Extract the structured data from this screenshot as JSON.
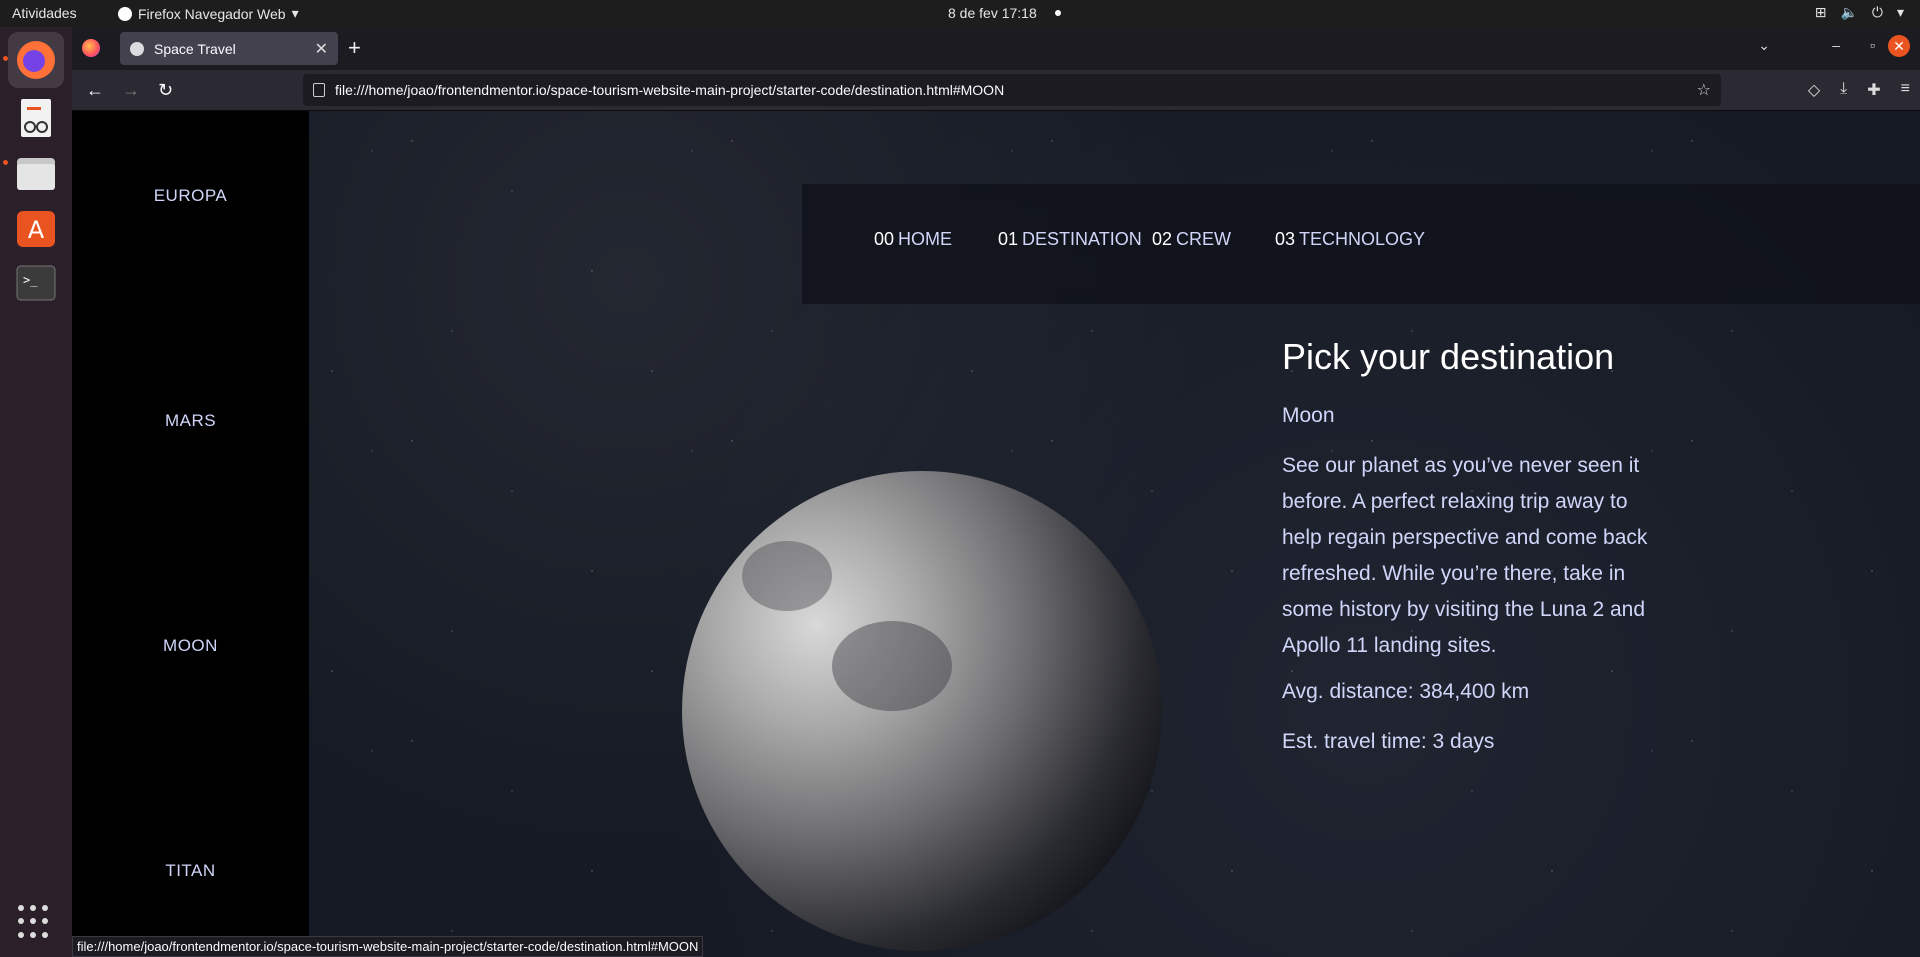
{
  "topbar": {
    "activities": "Atividades",
    "app_name": "Firefox Navegador Web",
    "clock": "8 de fev  17:18"
  },
  "browser": {
    "tab_title": "Space Travel",
    "url": "file:///home/joao/frontendmentor.io/space-tourism-website-main-project/starter-code/destination.html#MOON",
    "status_url": "file:///home/joao/frontendmentor.io/space-tourism-website-main-project/starter-code/destination.html#MOON"
  },
  "sidebar": {
    "destinations": [
      "EUROPA",
      "MARS",
      "MOON",
      "TITAN"
    ]
  },
  "nav": {
    "items": [
      {
        "num": "00",
        "label": "HOME"
      },
      {
        "num": "01",
        "label": "DESTINATION"
      },
      {
        "num": "02",
        "label": "CREW"
      },
      {
        "num": "03",
        "label": "TECHNOLOGY"
      }
    ]
  },
  "main": {
    "title": "Pick your destination",
    "destination": "Moon",
    "description": "See our planet as you’ve never seen it before. A perfect relaxing trip away to help regain perspective and come back refreshed. While you’re there, take in some history by visiting the Luna 2 and Apollo 11 landing sites.",
    "distance": "Avg. distance: 384,400 km",
    "travel_time": "Est. travel time: 3 days"
  },
  "colors": {
    "accent": "#e95420",
    "text_light": "#d0d6f9"
  }
}
